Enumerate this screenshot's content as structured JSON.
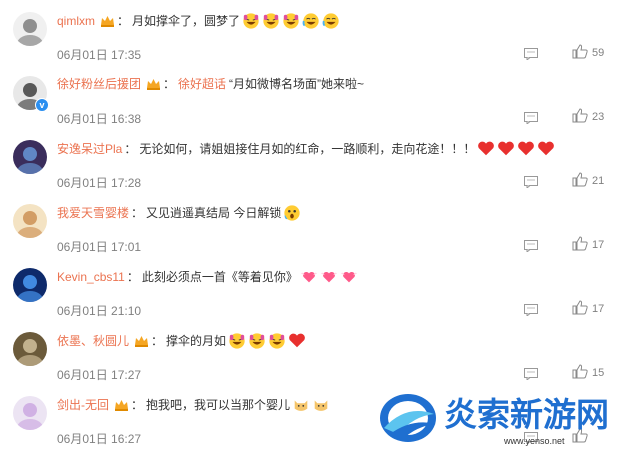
{
  "comments": [
    {
      "user": "qimlxm",
      "has_crown": true,
      "text": "月如撑伞了，圆梦了",
      "tag": "",
      "emojis": [
        "doge-laugh",
        "doge-laugh",
        "doge-laugh",
        "lol",
        "lol"
      ],
      "time": "06月01日 17:35",
      "likes": "59",
      "verified": false
    },
    {
      "user": "徐好粉丝后援团",
      "has_crown": true,
      "text": "“月如微博名场面”她来啦~",
      "tag": "徐好超话",
      "emojis": [],
      "time": "06月01日 16:38",
      "likes": "23",
      "verified": true
    },
    {
      "user": "安逸呆过Pla",
      "has_crown": false,
      "text": "无论如何，请姐姐接住月如的红命，一路顺利，走向花途！！！",
      "tag": "",
      "emojis": [
        "heart",
        "heart",
        "heart",
        "heart"
      ],
      "time": "06月01日 17:28",
      "likes": "21",
      "verified": false
    },
    {
      "user": "我爱天雪婴楼",
      "has_crown": false,
      "text": "又见逍遥真结局 今日解锁",
      "tag": "",
      "emojis": [
        "shock"
      ],
      "time": "06月01日 17:01",
      "likes": "17",
      "verified": false
    },
    {
      "user": "Kevin_cbs11",
      "has_crown": false,
      "text": "此刻必须点一首《等着见你》",
      "tag": "",
      "emojis": [
        "flying-heart",
        "flying-heart",
        "flying-heart"
      ],
      "time": "06月01日 21:10",
      "likes": "17",
      "verified": false
    },
    {
      "user": "依墨、秋圆儿",
      "has_crown": true,
      "text": "撑伞的月如",
      "tag": "",
      "emojis": [
        "doge-laugh",
        "doge-laugh",
        "doge-laugh",
        "heart"
      ],
      "time": "06月01日 17:27",
      "likes": "15",
      "verified": false
    },
    {
      "user": "剑出-无回",
      "has_crown": true,
      "text": "抱我吧，我可以当那个婴儿",
      "tag": "",
      "emojis": [
        "cat",
        "cat"
      ],
      "time": "06月01日 16:27",
      "likes": "",
      "verified": false
    }
  ],
  "watermark": {
    "title": "炎索新游网",
    "url": "www.yenso.net"
  }
}
